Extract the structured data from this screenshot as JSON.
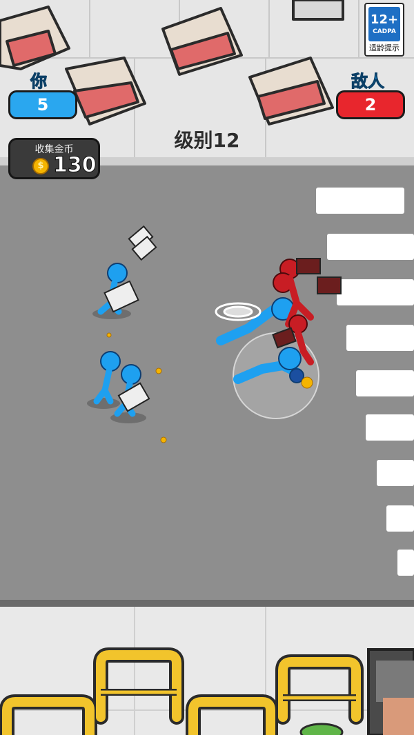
{
  "hud": {
    "player_label": "你",
    "player_count": "5",
    "enemy_label": "敌人",
    "enemy_count": "2",
    "player_color": "#2aa7ef",
    "enemy_color": "#e8262d"
  },
  "coins": {
    "title": "收集金币",
    "value": "130",
    "icon": "coin-icon"
  },
  "level": {
    "text": "级别12"
  },
  "age_rating": {
    "rating": "12+",
    "org": "CADPA",
    "tip": "适龄提示"
  },
  "colors": {
    "road": "#8e8e8e",
    "sidewalk": "#e9e9e9",
    "blue_team": "#1ea0f0",
    "red_team": "#c81d24",
    "barrier_yellow": "#f2c42c"
  }
}
